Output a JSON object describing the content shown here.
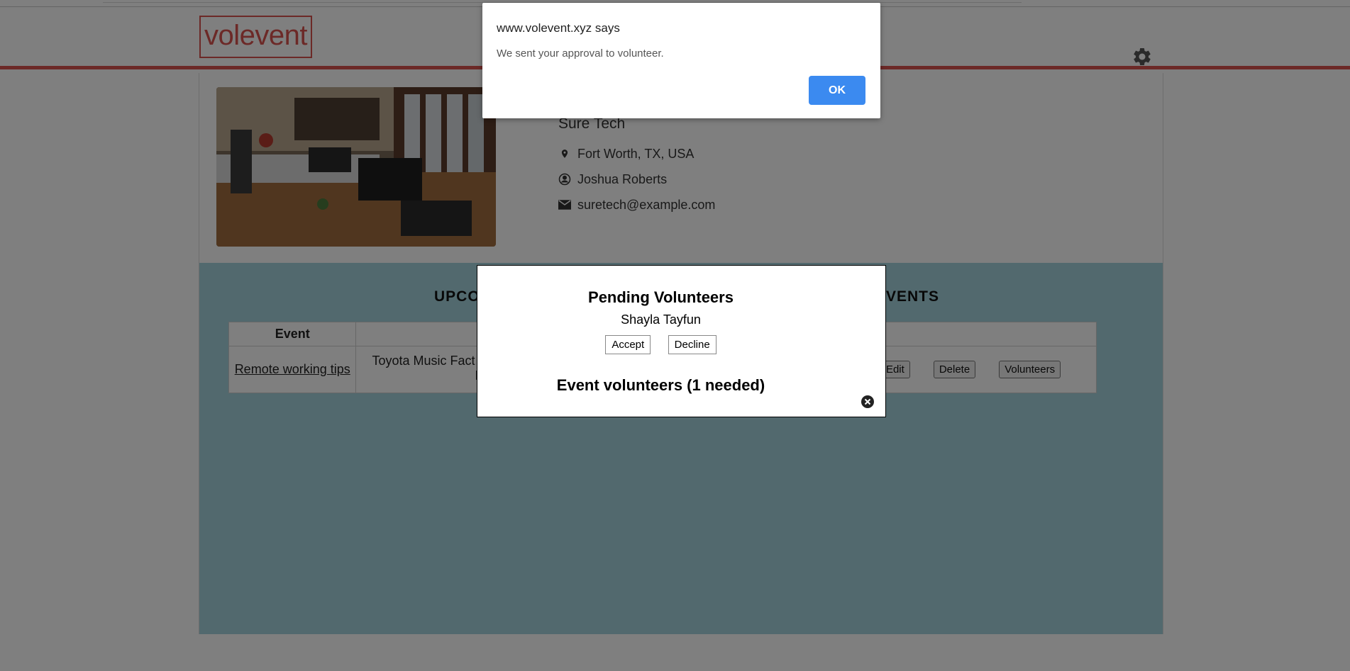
{
  "header": {
    "logo_text": "volevent"
  },
  "profile": {
    "name": "Sure Tech",
    "location": "Fort Worth, TX, USA",
    "contact": "Joshua Roberts",
    "email": "suretech@example.com"
  },
  "events": {
    "title_left": "UPCO",
    "title_right": "VENTS",
    "columns": [
      "Event",
      "",
      "",
      ""
    ],
    "rows": [
      {
        "event": "Remote working tips",
        "venue_line1": "Toyota Music Fact",
        "venue_line2": "I",
        "edit": "Edit",
        "delete": "Delete",
        "volunteers": "Volunteers"
      }
    ]
  },
  "modal": {
    "title": "Pending Volunteers",
    "volunteer_name": "Shayla Tayfun",
    "accept": "Accept",
    "decline": "Decline",
    "event_volunteers": "Event volunteers (1 needed)"
  },
  "alert": {
    "origin": "www.volevent.xyz says",
    "message": "We sent your approval to volunteer.",
    "ok": "OK"
  },
  "colors": {
    "brand": "#d9534f",
    "events_bg": "#a4d3dc",
    "ok_button": "#3b8af0"
  },
  "icons": [
    "settings-gear-icon",
    "location-pin-icon",
    "person-icon",
    "envelope-icon",
    "close-circle-icon"
  ]
}
